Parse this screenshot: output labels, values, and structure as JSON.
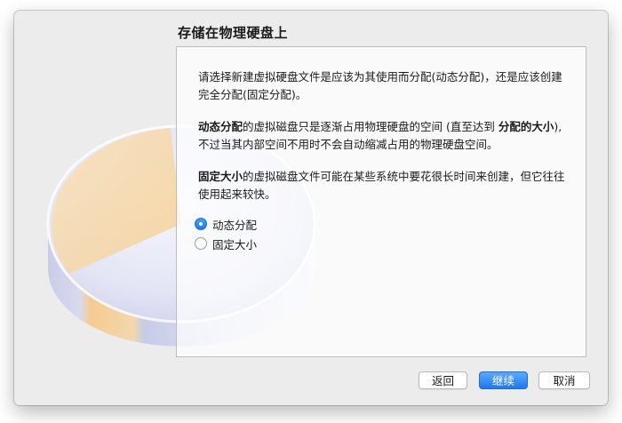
{
  "dialog": {
    "title": "存储在物理硬盘上"
  },
  "content": {
    "intro": "请选择新建虚拟硬盘文件是应该为其使用而分配(动态分配)，还是应该创建完全分配(固定分配)。",
    "dynamic_bold": "动态分配",
    "dynamic_text_a": "的虚拟磁盘只是逐渐占用物理硬盘的空间 (直至达到 ",
    "dynamic_bold_2": "分配的大小",
    "dynamic_text_b": "), 不过当其内部空间不用时不会自动缩减占用的物理硬盘空间。",
    "fixed_bold": "固定大小",
    "fixed_text": "的虚拟磁盘文件可能在某些系统中要花很长时间来创建，但它往往使用起来较快。"
  },
  "options": [
    {
      "label": "动态分配",
      "selected": true
    },
    {
      "label": "固定大小",
      "selected": false
    }
  ],
  "buttons": {
    "back": "返回",
    "next": "继续",
    "cancel": "取消"
  },
  "colors": {
    "accent": "#1f78f0",
    "window_bg": "#ececec"
  }
}
